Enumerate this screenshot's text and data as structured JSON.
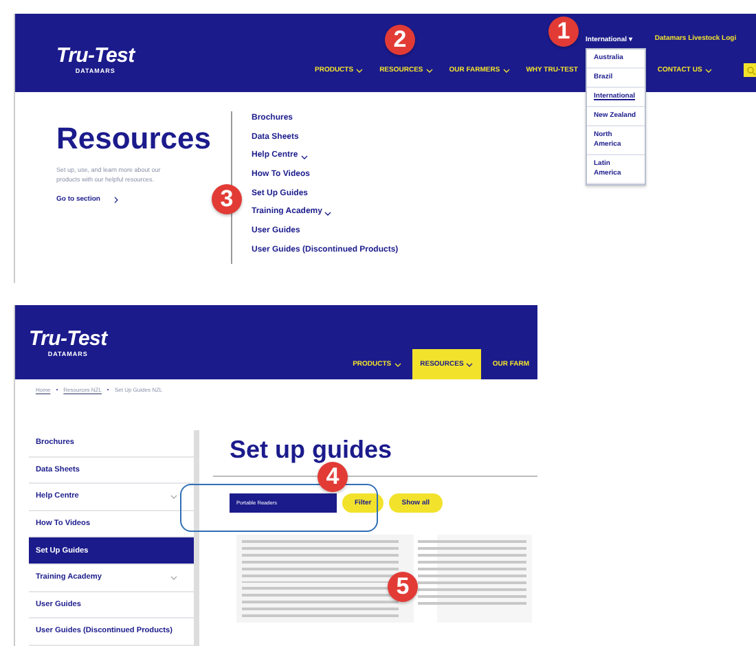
{
  "top_screenshot": {
    "logo": {
      "name": "Tru-Test",
      "sub": "DATAMARS"
    },
    "region_selector": {
      "label": "International",
      "caret": "▾",
      "options": [
        {
          "label": "Australia",
          "selected": false
        },
        {
          "label": "Brazil",
          "selected": false
        },
        {
          "label": "International",
          "selected": true
        },
        {
          "label": "New Zealand",
          "selected": false
        },
        {
          "label": "North America",
          "selected": false
        },
        {
          "label": "Latin America",
          "selected": false
        }
      ]
    },
    "login_link": "Datamars Livestock Logi",
    "nav": [
      {
        "label": "PRODUCTS",
        "has_menu": true
      },
      {
        "label": "RESOURCES",
        "has_menu": true
      },
      {
        "label": "OUR FARMERS",
        "has_menu": true
      },
      {
        "label": "WHY TRU-TEST",
        "has_menu": false
      },
      {
        "label": "CONTACT US",
        "has_menu": true
      }
    ],
    "menu": {
      "title": "Resources",
      "description": "Set up, use, and learn more about our products with our helpful resources.",
      "go_link": "Go to section",
      "links": [
        {
          "label": "Brochures",
          "has_submenu": false
        },
        {
          "label": "Data Sheets",
          "has_submenu": false
        },
        {
          "label": "Help Centre",
          "has_submenu": true
        },
        {
          "label": "How To Videos",
          "has_submenu": false
        },
        {
          "label": "Set Up Guides",
          "has_submenu": false
        },
        {
          "label": "Training Academy",
          "has_submenu": true
        },
        {
          "label": "User Guides",
          "has_submenu": false
        },
        {
          "label": "User Guides (Discontinued Products)",
          "has_submenu": false
        }
      ]
    }
  },
  "bottom_screenshot": {
    "logo": {
      "name": "Tru-Test",
      "sub": "DATAMARS"
    },
    "nav": [
      {
        "label": "PRODUCTS",
        "has_menu": true,
        "selected": false
      },
      {
        "label": "RESOURCES",
        "has_menu": true,
        "selected": true
      },
      {
        "label": "OUR FARM",
        "has_menu": false,
        "selected": false
      }
    ],
    "breadcrumb": [
      "Home",
      "Resources NZL",
      "Set Up Guides NZL"
    ],
    "sidebar": [
      {
        "label": "Brochures",
        "has_submenu": false,
        "selected": false
      },
      {
        "label": "Data Sheets",
        "has_submenu": false,
        "selected": false
      },
      {
        "label": "Help Centre",
        "has_submenu": true,
        "selected": false
      },
      {
        "label": "How To Videos",
        "has_submenu": false,
        "selected": false
      },
      {
        "label": "Set Up Guides",
        "has_submenu": false,
        "selected": true
      },
      {
        "label": "Training Academy",
        "has_submenu": true,
        "selected": false
      },
      {
        "label": "User Guides",
        "has_submenu": false,
        "selected": false
      },
      {
        "label": "User Guides (Discontinued Products)",
        "has_submenu": false,
        "selected": false
      }
    ],
    "title": "Set up guides",
    "filter": {
      "value": "Portable Readers",
      "button": "Filter",
      "reset": "Show all"
    }
  },
  "annotations": [
    "1",
    "2",
    "3",
    "4",
    "5"
  ]
}
